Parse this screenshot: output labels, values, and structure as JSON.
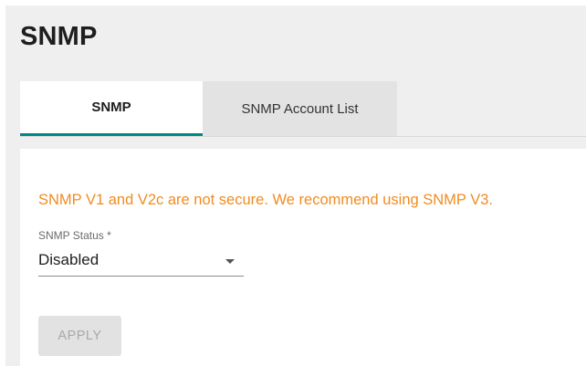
{
  "page": {
    "title": "SNMP"
  },
  "tabs": [
    {
      "label": "SNMP",
      "active": true
    },
    {
      "label": "SNMP Account List",
      "active": false
    }
  ],
  "warning": {
    "text": "SNMP V1 and V2c are not secure. We recommend using SNMP V3.",
    "color": "#f18c23"
  },
  "form": {
    "snmp_status": {
      "label": "SNMP Status *",
      "value": "Disabled"
    }
  },
  "actions": {
    "apply_label": "APPLY",
    "apply_disabled": true
  },
  "colors": {
    "accent": "#008787",
    "warning": "#f18c23",
    "background": "#efefef"
  }
}
